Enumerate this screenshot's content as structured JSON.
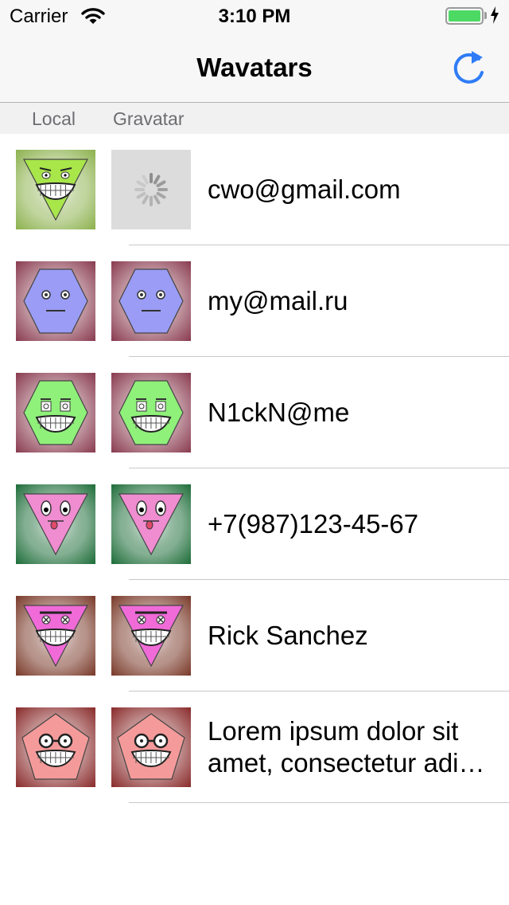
{
  "status_bar": {
    "carrier": "Carrier",
    "time": "3:10 PM",
    "battery_color": "#4cd964"
  },
  "nav": {
    "title": "Wavatars",
    "refresh_icon": "refresh-icon",
    "accent": "#2f7cf6"
  },
  "section_header": {
    "local": "Local",
    "gravatar": "Gravatar"
  },
  "rows": [
    {
      "label": "cwo@gmail.com",
      "gravatar_state": "loading",
      "avatar": {
        "shape": "triangle-down",
        "face": "#a8e64a",
        "bg": "#8db24f",
        "eyes": "angry",
        "mouth": "grin"
      }
    },
    {
      "label": "my@mail.ru",
      "gravatar_state": "loaded",
      "avatar": {
        "shape": "hexagon",
        "face": "#9a9cf5",
        "bg": "#8a3c50",
        "eyes": "round",
        "mouth": "flat"
      }
    },
    {
      "label": "N1ckN@me",
      "gravatar_state": "loaded",
      "avatar": {
        "shape": "hexagon",
        "face": "#8ff07a",
        "bg": "#8a3c50",
        "eyes": "spiral",
        "mouth": "grin"
      }
    },
    {
      "label": "+7(987)123-45-67",
      "gravatar_state": "loaded",
      "avatar": {
        "shape": "triangle-down",
        "face": "#f08cd0",
        "bg": "#1f6e3a",
        "eyes": "big",
        "mouth": "tongue"
      }
    },
    {
      "label": "Rick Sanchez",
      "gravatar_state": "loaded",
      "avatar": {
        "shape": "triangle-down",
        "face": "#f06ad8",
        "bg": "#7a3a2a",
        "eyes": "x",
        "mouth": "grin"
      }
    },
    {
      "label": "Lorem ipsum dolor sit amet, consectetur adi…",
      "gravatar_state": "loaded",
      "avatar": {
        "shape": "pentagon",
        "face": "#f59a9a",
        "bg": "#8a2c2c",
        "eyes": "glasses",
        "mouth": "grin"
      }
    }
  ]
}
